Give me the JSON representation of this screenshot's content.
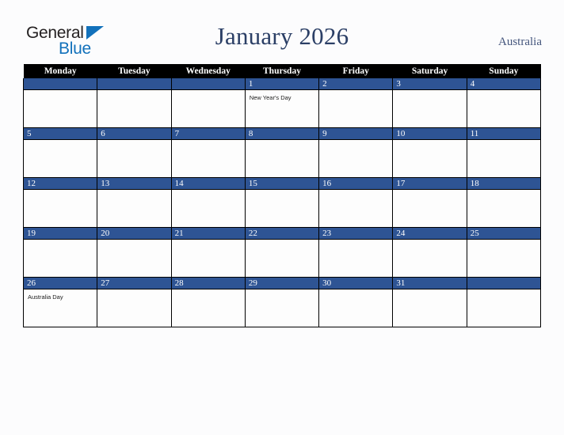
{
  "brand": {
    "name_part1": "General",
    "name_part2": "Blue",
    "triangle_icon": "triangle-icon",
    "accent_color": "#1271bb"
  },
  "header": {
    "title": "January 2026",
    "country": "Australia",
    "title_color": "#2b3f66"
  },
  "calendar": {
    "weekday_headers": [
      "Monday",
      "Tuesday",
      "Wednesday",
      "Thursday",
      "Friday",
      "Saturday",
      "Sunday"
    ],
    "header_bg": "#000000",
    "daybar_bg": "#2e5494",
    "cell_bg": "#fdfdfd",
    "weeks": [
      [
        {
          "day": "",
          "event": ""
        },
        {
          "day": "",
          "event": ""
        },
        {
          "day": "",
          "event": ""
        },
        {
          "day": "1",
          "event": "New Year's Day"
        },
        {
          "day": "2",
          "event": ""
        },
        {
          "day": "3",
          "event": ""
        },
        {
          "day": "4",
          "event": ""
        }
      ],
      [
        {
          "day": "5",
          "event": ""
        },
        {
          "day": "6",
          "event": ""
        },
        {
          "day": "7",
          "event": ""
        },
        {
          "day": "8",
          "event": ""
        },
        {
          "day": "9",
          "event": ""
        },
        {
          "day": "10",
          "event": ""
        },
        {
          "day": "11",
          "event": ""
        }
      ],
      [
        {
          "day": "12",
          "event": ""
        },
        {
          "day": "13",
          "event": ""
        },
        {
          "day": "14",
          "event": ""
        },
        {
          "day": "15",
          "event": ""
        },
        {
          "day": "16",
          "event": ""
        },
        {
          "day": "17",
          "event": ""
        },
        {
          "day": "18",
          "event": ""
        }
      ],
      [
        {
          "day": "19",
          "event": ""
        },
        {
          "day": "20",
          "event": ""
        },
        {
          "day": "21",
          "event": ""
        },
        {
          "day": "22",
          "event": ""
        },
        {
          "day": "23",
          "event": ""
        },
        {
          "day": "24",
          "event": ""
        },
        {
          "day": "25",
          "event": ""
        }
      ],
      [
        {
          "day": "26",
          "event": "Australia Day"
        },
        {
          "day": "27",
          "event": ""
        },
        {
          "day": "28",
          "event": ""
        },
        {
          "day": "29",
          "event": ""
        },
        {
          "day": "30",
          "event": ""
        },
        {
          "day": "31",
          "event": ""
        },
        {
          "day": "",
          "event": ""
        }
      ]
    ]
  }
}
